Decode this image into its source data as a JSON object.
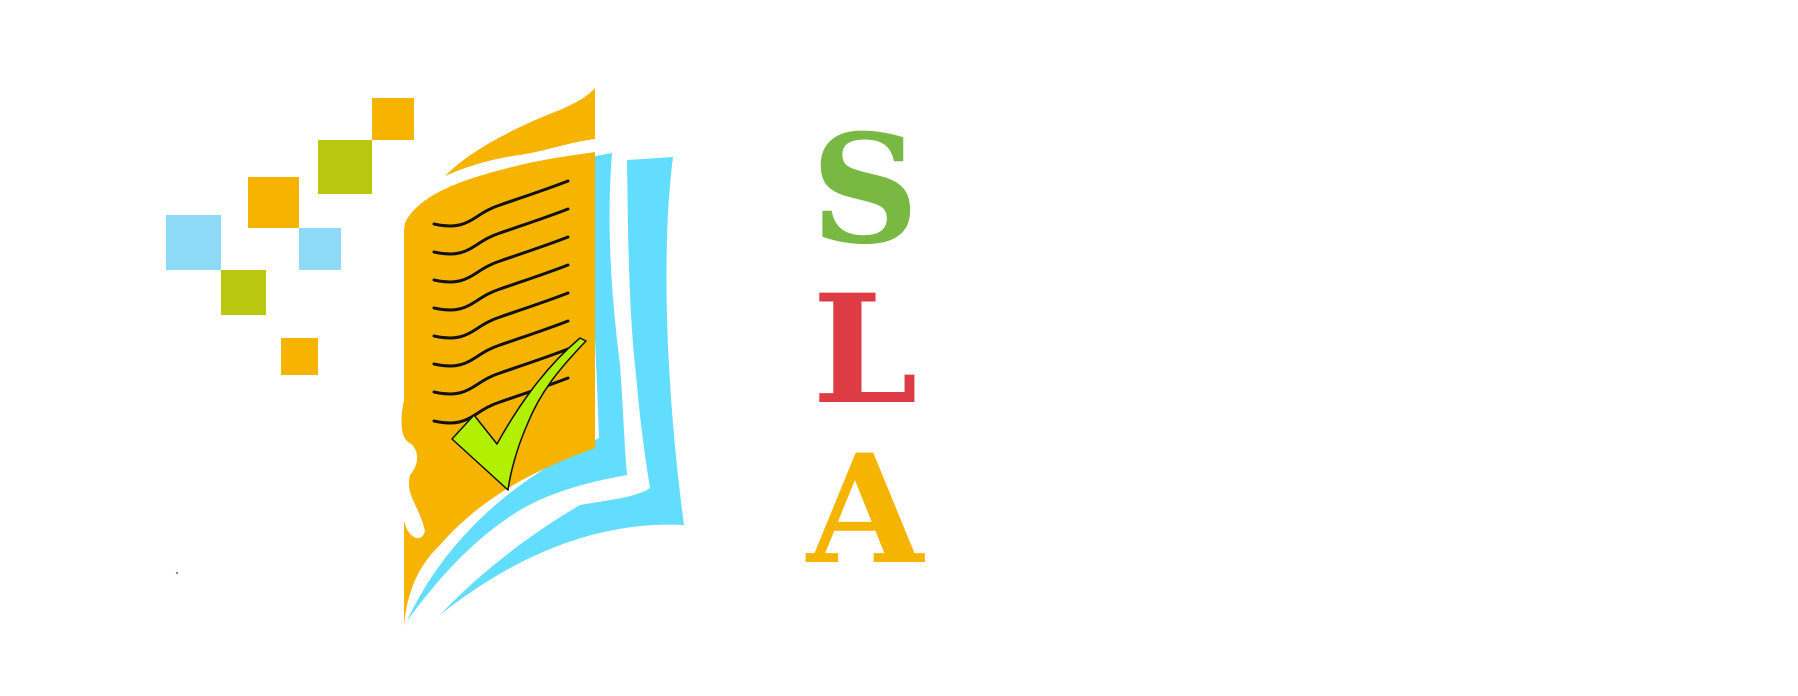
{
  "logo": {
    "icon": "open-book-checklist-icon",
    "letters": [
      {
        "text": "S",
        "color": "#79b843"
      },
      {
        "text": "L",
        "color": "#dd3c44"
      },
      {
        "text": "A",
        "color": "#f4b400"
      }
    ]
  },
  "colors": {
    "orange": "#f6b400",
    "olive": "#bac70f",
    "light_blue": "#8ed9f6",
    "cyan": "#63ddfd",
    "check_green": "#b2ef00"
  }
}
